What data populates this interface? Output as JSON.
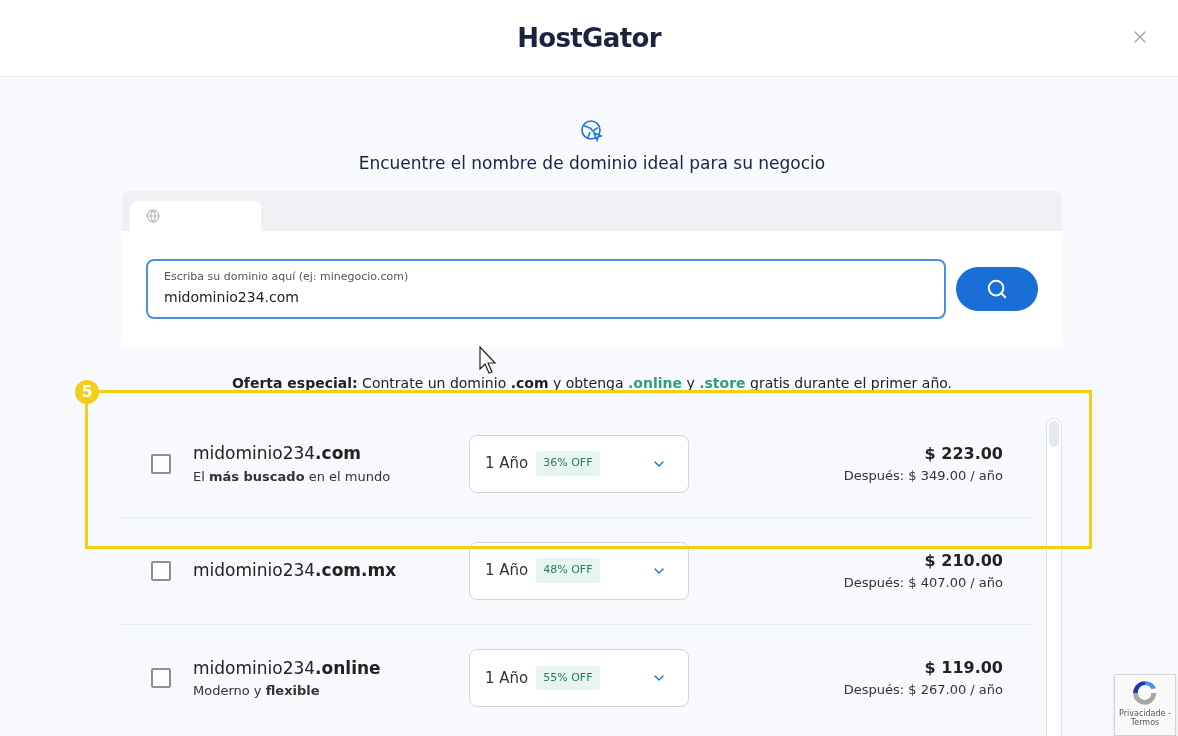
{
  "header": {
    "logo": "HostGator"
  },
  "search": {
    "heading": "Encuentre el nombre de dominio ideal para su negocio",
    "placeholder": "Escriba su dominio aquí (ej: minegocio.com)",
    "value": "midominio234.com"
  },
  "offer": [
    {
      "kind": "bold",
      "text": "Oferta especial:"
    },
    {
      "kind": "plain",
      "text": " Contrate un dominio "
    },
    {
      "kind": "bold",
      "text": ".com"
    },
    {
      "kind": "plain",
      "text": " y obtenga "
    },
    {
      "kind": "green",
      "text": ".online"
    },
    {
      "kind": "plain",
      "text": " y "
    },
    {
      "kind": "green",
      "text": ".store"
    },
    {
      "kind": "plain",
      "text": " gratis durante el primer año."
    }
  ],
  "annotation": {
    "label": "5"
  },
  "results": [
    {
      "name": "midominio234**.com**",
      "subtitle": "El **más buscado** en el mundo",
      "checked": false,
      "term": "1 Año",
      "discount": "36% OFF",
      "price": "$ 223.00",
      "after": "Después: $ 349.00 / año"
    },
    {
      "name": "midominio234**.com.mx**",
      "checked": false,
      "term": "1 Año",
      "discount": "48% OFF",
      "price": "$ 210.00",
      "after": "Después: $ 407.00 / año"
    },
    {
      "name": "midominio234**.online**",
      "subtitle": "Moderno y **flexible**",
      "checked": false,
      "term": "1 Año",
      "discount": "55% OFF",
      "price": "$ 119.00",
      "after": "Después: $ 267.00 / año"
    }
  ],
  "recaptcha": {
    "text": "Privacidade - Termos"
  }
}
